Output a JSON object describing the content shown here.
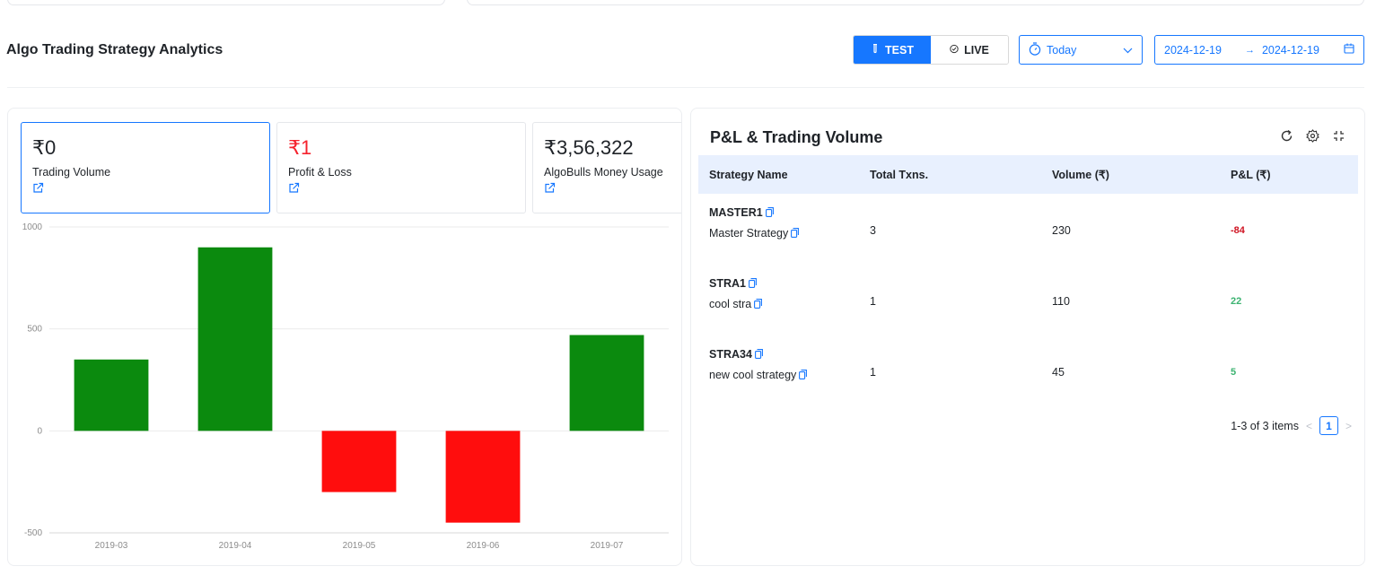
{
  "page": {
    "title": "Algo Trading Strategy Analytics"
  },
  "mode": {
    "test_label": "TEST",
    "live_label": "LIVE",
    "selected": "TEST"
  },
  "range_select": {
    "value": "Today",
    "icon": "stopwatch-icon"
  },
  "date_range": {
    "start": "2024-12-19",
    "end": "2024-12-19",
    "icon": "calendar-icon"
  },
  "stats": [
    {
      "value": "₹0",
      "label": "Trading Volume",
      "selected": true
    },
    {
      "value": "₹1",
      "label": "Profit & Loss",
      "selected": false
    },
    {
      "value": "₹3,56,322",
      "label": "AlgoBulls Money Usage",
      "selected": false
    }
  ],
  "chart_data": {
    "type": "bar",
    "categories": [
      "2019-03",
      "2019-04",
      "2019-05",
      "2019-06",
      "2019-07"
    ],
    "values": [
      350,
      900,
      -300,
      -450,
      470
    ],
    "ylim": [
      -500,
      1000
    ],
    "yticks": [
      1000,
      500,
      0,
      -500
    ],
    "grid": true,
    "colors": {
      "positive": "#0b8a0e",
      "negative": "#ff0d0d"
    }
  },
  "panel": {
    "title": "P&L & Trading Volume",
    "actions": [
      "reload-icon",
      "settings-icon",
      "fullscreen-icon"
    ],
    "columns": [
      "Strategy Name",
      "Total Txns.",
      "Volume (₹)",
      "P&L (₹)"
    ],
    "rows": [
      {
        "code": "MASTER1",
        "name": "Master Strategy",
        "txns": "3",
        "volume": "230",
        "pnl": "-84"
      },
      {
        "code": "STRA1",
        "name": "cool stra",
        "txns": "1",
        "volume": "110",
        "pnl": "22"
      },
      {
        "code": "STRA34",
        "name": "new cool strategy",
        "txns": "1",
        "volume": "45",
        "pnl": "5"
      }
    ],
    "pagination": {
      "summary": "1-3 of 3 items",
      "current_page": "1",
      "prev": "<",
      "next": ">"
    }
  },
  "colors": {
    "accent": "#1677ff",
    "loss": "#cf1322",
    "profit": "#3cb371",
    "header_bg": "#e8f0fe"
  }
}
